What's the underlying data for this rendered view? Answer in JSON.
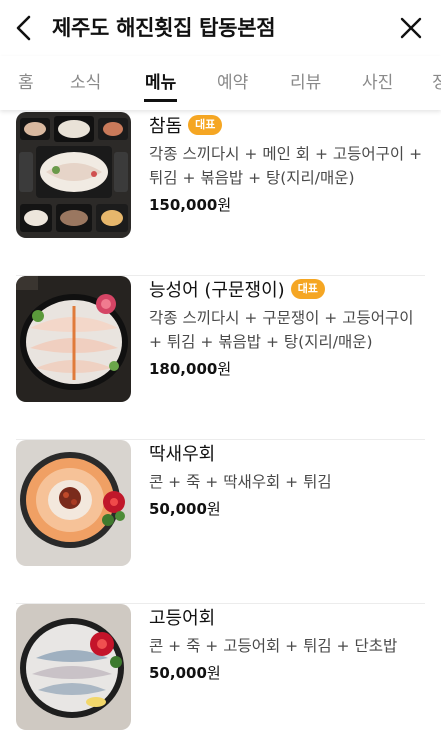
{
  "header": {
    "title": "제주도 해진횟집 탑동본점",
    "back_icon": "chevron-left-icon",
    "close_icon": "close-icon"
  },
  "tabs": [
    {
      "label": "홈"
    },
    {
      "label": "소식"
    },
    {
      "label": "메뉴",
      "active": true
    },
    {
      "label": "예약"
    },
    {
      "label": "리뷰"
    },
    {
      "label": "사진"
    },
    {
      "label": "정"
    }
  ],
  "menu": [
    {
      "name": "참돔",
      "badge": "대표",
      "description": "각종 스끼다시 + 메인 회 + 고등어구이 + 튀김 + 볶음밥 + 탕(지리/매운)",
      "price_number": "150,000",
      "price_unit": "원"
    },
    {
      "name": "능성어 (구문쟁이)",
      "badge": "대표",
      "description": "각종 스끼다시 + 구문쟁이 + 고등어구이 + 튀김 + 볶음밥 + 탕(지리/매운)",
      "price_number": "180,000",
      "price_unit": "원"
    },
    {
      "name": "딱새우회",
      "badge": "",
      "description": "콘 + 죽 + 딱새우회 + 튀김",
      "price_number": "50,000",
      "price_unit": "원"
    },
    {
      "name": "고등어회",
      "badge": "",
      "description": "콘 + 죽 + 고등어회 + 튀김 + 단초밥",
      "price_number": "50,000",
      "price_unit": "원"
    }
  ],
  "colors": {
    "badge": "#f5a623",
    "active_tab": "#111111",
    "inactive_tab": "#8a8a8a"
  }
}
